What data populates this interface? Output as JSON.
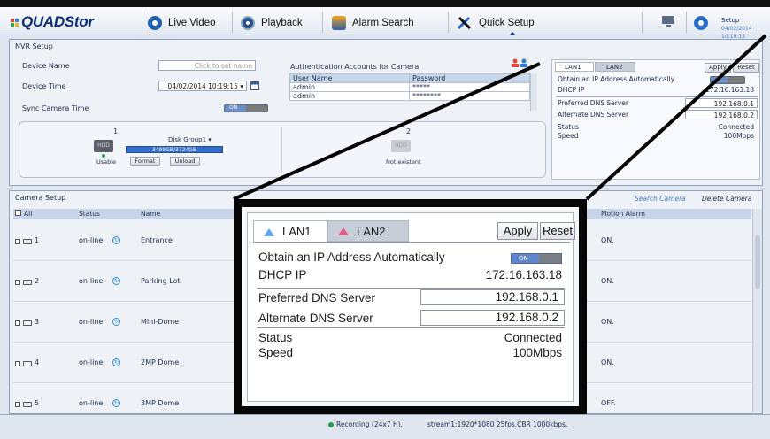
{
  "topbar": {
    "logo_text": "QUADStor",
    "nav": [
      {
        "label": "Live Video",
        "icon": "live-video-icon"
      },
      {
        "label": "Playback",
        "icon": "playback-icon"
      },
      {
        "label": "Alarm Search",
        "icon": "alarm-search-icon"
      },
      {
        "label": "Quick Setup",
        "icon": "quick-setup-icon"
      }
    ],
    "setup_label": "Setup",
    "setup_date": "04/02/2014 10:19:15"
  },
  "nvr_setup": {
    "title": "NVR Setup",
    "device_name_label": "Device Name",
    "device_name_placeholder": "Click to set name",
    "device_time_label": "Device Time",
    "device_time_value": "04/02/2014 10:19:15",
    "sync_label": "Sync Camera Time",
    "sync_toggle": "ON"
  },
  "auth": {
    "title": "Authentication Accounts for Camera",
    "headers": [
      "User Name",
      "Password"
    ],
    "rows": [
      [
        "admin",
        "*****"
      ],
      [
        "admin",
        "********"
      ]
    ]
  },
  "disks": {
    "disk1_num": "1",
    "disk1_group": "Disk Group1",
    "disk1_capacity": "3499GB/3724GB",
    "disk1_state": "Usable",
    "format_label": "Format",
    "unload_label": "Unload",
    "disk2_num": "2",
    "disk2_state": "Not existent",
    "hdd_text": "HDD"
  },
  "network_small": {
    "lan1": "LAN1",
    "lan2": "LAN2",
    "apply": "Apply",
    "reset": "Reset",
    "obtain": "Obtain an IP Address Automatically",
    "dhcp_label": "DHCP IP",
    "dhcp_value": "172.16.163.18",
    "pdns_label": "Preferred DNS Server",
    "pdns_value": "192.168.0.1",
    "adns_label": "Alternate DNS Server",
    "adns_value": "192.168.0.2",
    "status_label": "Status",
    "status_value": "Connected",
    "speed_label": "Speed",
    "speed_value": "100Mbps"
  },
  "network_zoom": {
    "lan1": "LAN1",
    "lan2": "LAN2",
    "apply": "Apply",
    "reset": "Reset",
    "obtain": "Obtain an IP Address Automatically",
    "toggle": "ON",
    "dhcp_label": "DHCP IP",
    "dhcp_value": "172.16.163.18",
    "pdns_label": "Preferred DNS Server",
    "pdns_value": "192.168.0.1",
    "adns_label": "Alternate DNS Server",
    "adns_value": "192.168.0.2",
    "status_label": "Status",
    "status_value": "Connected",
    "speed_label": "Speed",
    "speed_value": "100Mbps"
  },
  "camera_setup": {
    "title": "Camera Setup",
    "search": "Search Camera",
    "delete": "Delete Camera",
    "headers": {
      "all": "All",
      "status": "Status",
      "name": "Name",
      "motion": "Motion Alarm"
    },
    "rows": [
      {
        "num": "1",
        "status": "on-line",
        "name": "Entrance",
        "motion": "ON."
      },
      {
        "num": "2",
        "status": "on-line",
        "name": "Parking Lot",
        "motion": "ON."
      },
      {
        "num": "3",
        "status": "on-line",
        "name": "Mini-Dome",
        "motion": "ON."
      },
      {
        "num": "4",
        "status": "on-line",
        "name": "2MP Dome",
        "motion": "ON."
      },
      {
        "num": "5",
        "status": "on-line",
        "name": "3MP Dome",
        "motion": "OFF."
      }
    ]
  },
  "status_bar": {
    "recording": "Recording (24x7 H).",
    "stream": "stream1:1920*1080 25fps,CBR 1000kbps."
  },
  "colors": {
    "accent": "#0b2f78",
    "link": "#3f7cc6",
    "online": "#2a8ad8",
    "recording": "#25a244"
  }
}
